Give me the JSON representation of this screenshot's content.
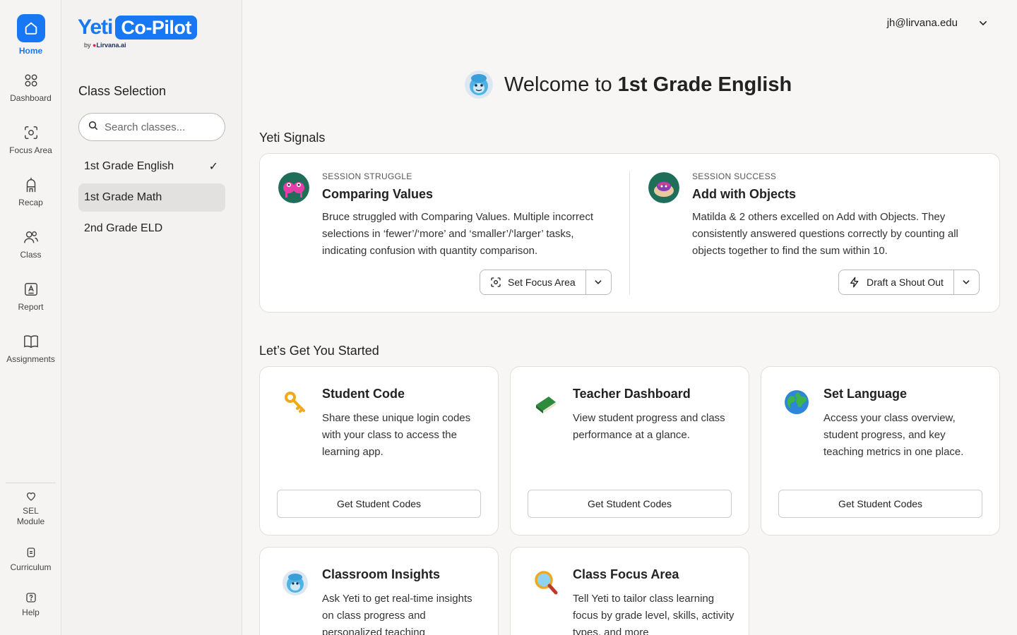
{
  "rail": {
    "items": [
      {
        "label": "Home",
        "icon": "home-icon",
        "active": true
      },
      {
        "label": "Dashboard",
        "icon": "grid-icon"
      },
      {
        "label": "Focus Area",
        "icon": "focus-icon"
      },
      {
        "label": "Recap",
        "icon": "recap-icon"
      },
      {
        "label": "Class",
        "icon": "users-icon"
      },
      {
        "label": "Report",
        "icon": "report-icon"
      },
      {
        "label": "Assignments",
        "icon": "book-icon"
      }
    ],
    "bottom": [
      {
        "label": "SEL\nModule",
        "icon": "heart-icon"
      },
      {
        "label": "Curriculum",
        "icon": "document-icon"
      },
      {
        "label": "Help",
        "icon": "help-icon"
      }
    ],
    "accent": "#1877f2"
  },
  "brand": {
    "name_part1": "Yeti",
    "name_part2": "Co-Pilot",
    "by_text": "by",
    "by_brand": "Lirvana.ai"
  },
  "classbar": {
    "title": "Class Selection",
    "search_placeholder": "Search classes...",
    "classes": [
      {
        "label": "1st Grade English",
        "selected": true
      },
      {
        "label": "1st Grade Math",
        "hovered": true
      },
      {
        "label": "2nd Grade ELD"
      }
    ]
  },
  "header": {
    "user_email": "jh@lirvana.edu"
  },
  "welcome": {
    "prefix": "Welcome to ",
    "class_name": "1st Grade English"
  },
  "signals": {
    "title": "Yeti Signals",
    "items": [
      {
        "kicker": "SESSION STRUGGLE",
        "title": "Comparing Values",
        "description": "Bruce struggled with Comparing Values. Multiple incorrect selections in ‘fewer’/‘more’ and ‘smaller’/‘larger’ tasks, indicating confusion with quantity comparison.",
        "action": "Set Focus Area"
      },
      {
        "kicker": "SESSION SUCCESS",
        "title": "Add with Objects",
        "description": "Matilda & 2 others excelled on Add with Objects. They consistently answered questions correctly by counting all objects together to find the sum within 10.",
        "action": "Draft a Shout Out"
      }
    ]
  },
  "get_started": {
    "title": "Let’s Get You Started",
    "cards": [
      {
        "title": "Student Code",
        "description": "Share these unique login codes with your class to access the learning app.",
        "button": "Get Student Codes",
        "icon": "key-icon"
      },
      {
        "title": "Teacher Dashboard",
        "description": "View student progress and class performance at a glance.",
        "button": "Get Student Codes",
        "icon": "green-book-icon"
      },
      {
        "title": "Set Language",
        "description": "Access your class overview, student progress, and key teaching metrics in one place.",
        "button": "Get Student Codes",
        "icon": "globe-icon"
      },
      {
        "title": "Classroom Insights",
        "description": "Ask Yeti to get real-time insights on class progress and personalized teaching",
        "icon": "yeti-icon"
      },
      {
        "title": "Class Focus Area",
        "description": "Tell Yeti to tailor class learning focus by grade level, skills, activity types, and more",
        "icon": "magnifier-icon"
      }
    ]
  }
}
